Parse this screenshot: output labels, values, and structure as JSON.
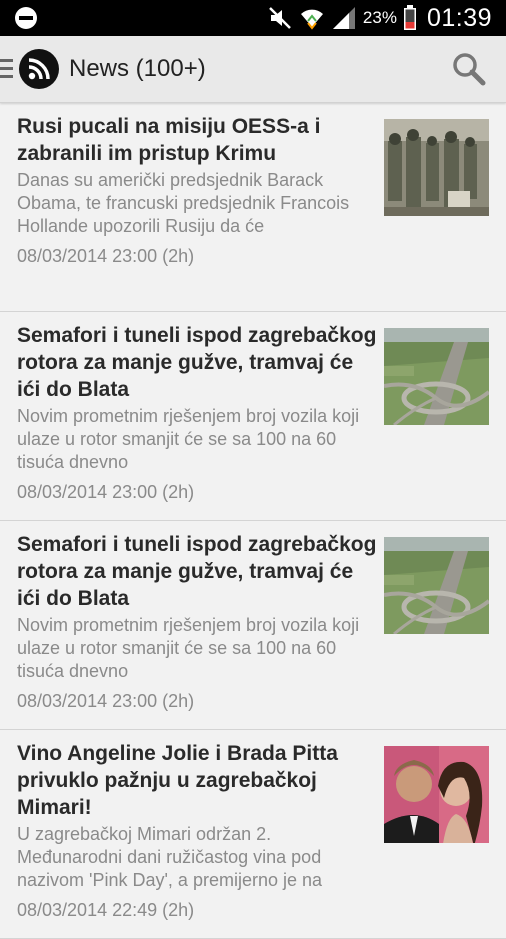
{
  "status_bar": {
    "battery_percent": "23%",
    "time": "01:39",
    "icons": [
      "do-not-disturb-icon",
      "mute-icon",
      "wifi-icon",
      "signal-icon",
      "battery-icon"
    ]
  },
  "action_bar": {
    "title": "News (100+)",
    "icons": [
      "drawer-icon",
      "rss-app-icon",
      "search-icon"
    ]
  },
  "articles": [
    {
      "title": "Rusi pucali na misiju OESS-a i zabranili im pristup Krimu",
      "summary": "Danas su američki predsjednik Barack Obama, te francuski predsjednik Francois Hollande upozorili Rusiju da će",
      "date": "08/03/2014 23:00 (2h)",
      "thumbnail": "soldiers-photo"
    },
    {
      "title": "Semafori i tuneli ispod zagrebačkog rotora za manje gužve, tramvaj će ići do Blata",
      "summary": "Novim prometnim rješenjem broj vozila koji ulaze u rotor smanjit će se sa 100 na 60 tisuća dnevno",
      "date": "08/03/2014 23:00 (2h)",
      "thumbnail": "interchange-photo"
    },
    {
      "title": "Semafori i tuneli ispod zagrebačkog rotora za manje gužve, tramvaj će ići do Blata",
      "summary": "Novim prometnim rješenjem broj vozila koji ulaze u rotor smanjit će se sa 100 na 60 tisuća dnevno",
      "date": "08/03/2014 23:00 (2h)",
      "thumbnail": "interchange-photo"
    },
    {
      "title": "Vino Angeline Jolie i Brada Pitta privuklo pažnju u zagrebačkoj Mimari!",
      "summary": "U zagrebačkoj Mimari održan 2. Međunarodni dani ružičastog vina pod nazivom 'Pink Day', a premijerno je na",
      "date": "08/03/2014 22:49 (2h)",
      "thumbnail": "couple-photo"
    }
  ],
  "colors": {
    "background": "#f2f2f2",
    "action_bar": "#e9e9e9",
    "title_text": "#2a2a2a",
    "secondary_text": "#8a8a8a",
    "battery_low": "#e53935"
  }
}
